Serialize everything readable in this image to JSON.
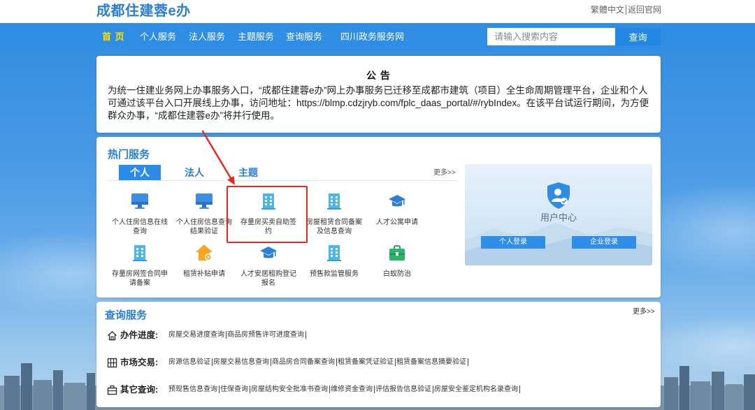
{
  "header": {
    "title": "成都住建蓉e办",
    "traditional_link": "繁體中文",
    "official_link": "返回官网"
  },
  "nav": {
    "items": [
      "首 页",
      "个人服务",
      "法人服务",
      "主题服务",
      "查询服务",
      "四川政务服务网"
    ],
    "active_index": 0,
    "search_placeholder": "请输入搜索内容",
    "search_button": "查询"
  },
  "notice": {
    "title": "公 告",
    "body": "为统一住建业务网上办事服务入口，“成都住建蓉e办”网上办事服务已迁移至成都市建筑（项目）全生命周期管理平台，企业和个人可通过该平台入口开展线上办事，访问地址：https://blmp.cdzjryb.com/fplc_daas_portal/#/rybIndex。在该平台试运行期间，为方便群众办事，“成都住建蓉e办”将并行使用。"
  },
  "hot_services": {
    "title": "热门服务",
    "tabs": [
      {
        "label": "个人",
        "active": true
      },
      {
        "label": "法人",
        "active": false
      },
      {
        "label": "主题",
        "active": false
      }
    ],
    "more": "更多>>",
    "items": [
      {
        "label": "个人住房信息在线查询",
        "icon": "monitor-icon"
      },
      {
        "label": "个人住房信息查询结果验证",
        "icon": "monitor-icon"
      },
      {
        "label": "存量房买卖自助签约",
        "icon": "building-icon",
        "highlighted": true
      },
      {
        "label": "房屋租赁合同备案及信息查询",
        "icon": "building-icon"
      },
      {
        "label": "人才公寓申请",
        "icon": "graduation-cap-icon"
      },
      {
        "label": "存量房网签合同申请备案",
        "icon": "building-icon"
      },
      {
        "label": "租赁补贴申请",
        "icon": "house-gear-icon"
      },
      {
        "label": "人才安居租购登记报名",
        "icon": "graduation-cap-icon"
      },
      {
        "label": "预售款监管服务",
        "icon": "building-icon"
      },
      {
        "label": "白蚁防治",
        "icon": "briefcase-icon"
      }
    ]
  },
  "user_center": {
    "title": "用户中心",
    "personal_login": "个人登录",
    "enterprise_login": "企业登录",
    "icon": "user-shield-icon"
  },
  "query_services": {
    "title": "查询服务",
    "more": "更多>>",
    "rows": [
      {
        "label": "办件进度:",
        "icon": "house-outline-icon",
        "links": [
          "房屋交易进度查询",
          "商品房预售许可进度查询"
        ]
      },
      {
        "label": "市场交易:",
        "icon": "building-grid-icon",
        "links": [
          "房源信息验证",
          "房屋交易信息查询",
          "商品房合同备案查询",
          "租赁备案凭证验证",
          "租赁备案信息摘要验证"
        ]
      },
      {
        "label": "其它查询:",
        "icon": "briefcase-outline-icon",
        "links": [
          "预现售信息查询",
          "住保查询",
          "房屋结构安全批准书查询",
          "维修资金查询",
          "评估报告信息验证",
          "房屋安全鉴定机构名录查询"
        ]
      }
    ]
  },
  "colors": {
    "brand_blue": "#2a80d6",
    "nav_background": "#2f8de3",
    "nav_active": "#ffe100",
    "login_button": "#2f8ee8",
    "annotation_red": "#e52a20"
  }
}
